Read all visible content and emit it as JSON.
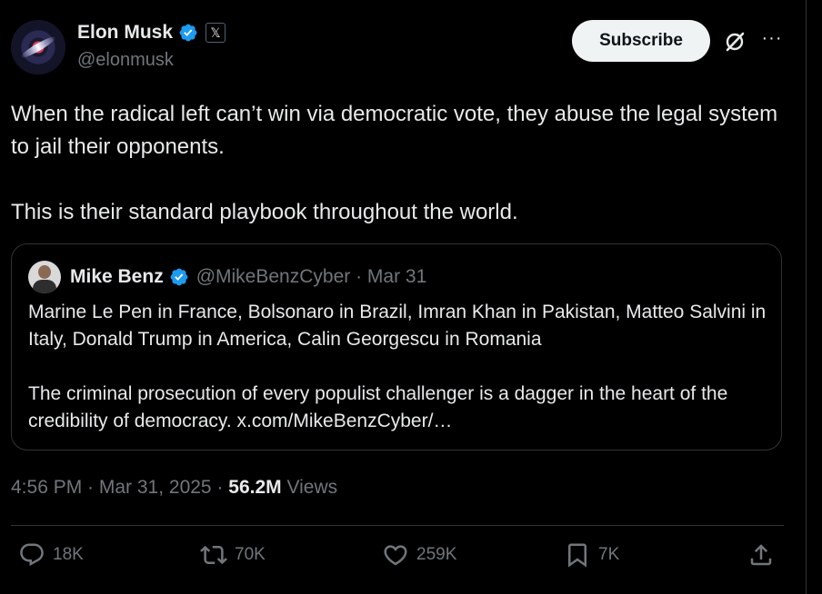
{
  "author": {
    "name": "Elon Musk",
    "handle": "@elonmusk",
    "badge_glyph": "𝕏"
  },
  "header": {
    "subscribe_label": "Subscribe",
    "more_glyph": "···"
  },
  "tweet": {
    "text": "When the radical left can’t win via democratic vote, they abuse the legal system to jail their opponents.\n\nThis is their standard playbook throughout the world."
  },
  "quote": {
    "name": "Mike Benz",
    "handle_date": "@MikeBenzCyber · Mar 31",
    "text": "Marine Le Pen in France, Bolsonaro in Brazil, Imran Khan in Pakistan, Matteo Salvini in Italy, Donald Trump in America, Calin Georgescu in Romania\n\nThe criminal prosecution of every populist challenger is a dagger in the heart of the credibility of democracy. x.com/MikeBenzCyber/…"
  },
  "meta": {
    "timestamp": "4:56 PM · Mar 31, 2025 · ",
    "views_count": "56.2M",
    "views_label": " Views"
  },
  "actions": {
    "replies": "18K",
    "reposts": "70K",
    "likes": "259K",
    "bookmarks": "7K"
  },
  "colors": {
    "background": "#000000",
    "text": "#e7e9ea",
    "muted": "#71767b",
    "verified": "#1d9bf0",
    "border": "#2f3336"
  }
}
